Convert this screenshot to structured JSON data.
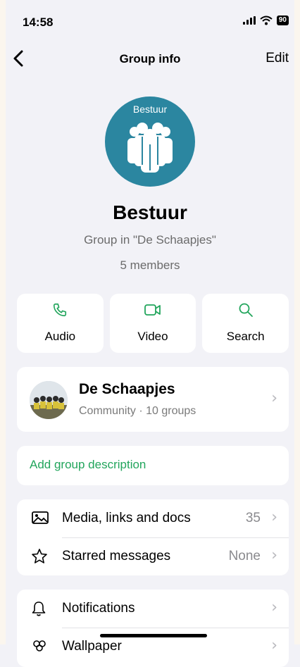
{
  "status_bar": {
    "time": "14:58",
    "battery": "90"
  },
  "nav": {
    "title": "Group info",
    "edit": "Edit"
  },
  "group": {
    "avatar_label": "Bestuur",
    "name": "Bestuur",
    "subtitle": "Group in \"De Schaapjes\"",
    "members": "5 members"
  },
  "actions": [
    {
      "label": "Audio",
      "icon": "phone-icon"
    },
    {
      "label": "Video",
      "icon": "video-icon"
    },
    {
      "label": "Search",
      "icon": "search-icon"
    }
  ],
  "community": {
    "name": "De Schaapjes",
    "subtitle": "Community · 10 groups"
  },
  "description": {
    "label": "Add group description"
  },
  "media_section": [
    {
      "label": "Media, links and docs",
      "value": "35",
      "icon": "image-icon"
    },
    {
      "label": "Starred messages",
      "value": "None",
      "icon": "star-icon"
    }
  ],
  "settings_section": [
    {
      "label": "Notifications",
      "icon": "bell-icon"
    },
    {
      "label": "Wallpaper",
      "icon": "wallpaper-icon"
    }
  ],
  "colors": {
    "accent": "#22a55c",
    "avatar_bg": "#2b86a0",
    "background": "#f2f2f7"
  }
}
